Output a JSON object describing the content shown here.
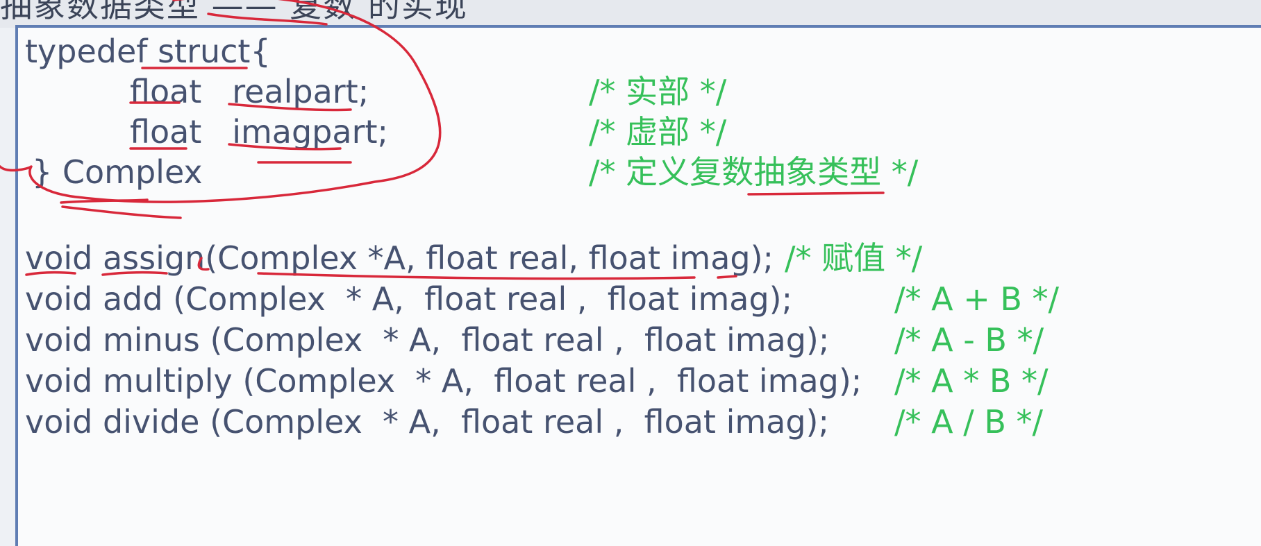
{
  "slide": {
    "cut_title": "抽象数据类型 —— 复数 的实现"
  },
  "code": {
    "struct_lines": [
      "typedef struct{",
      "float   realpart;",
      "float   imagpart;",
      "} Complex"
    ],
    "struct_comments": [
      "/* 实部 */",
      "/* 虚部 */",
      "/* 定义复数抽象类型 */"
    ],
    "function_lines": [
      "void assign(Complex *A, float real, float imag);",
      "void add (Complex  * A,  float real ,  float imag);",
      "void minus (Complex  * A,  float real ,  float imag);",
      "void multiply (Complex  * A,  float real ,  float imag);",
      "void divide (Complex  * A,  float real ,  float imag);"
    ],
    "function_comments": [
      "/* 赋值 */",
      "/* A + B */",
      "/* A - B */",
      "/* A * B */",
      "/* A / B */"
    ]
  },
  "colors": {
    "code_text": "#465270",
    "comment_text": "#36c05a",
    "annotation_ink": "#d8283a",
    "box_border": "#5f7db3"
  }
}
